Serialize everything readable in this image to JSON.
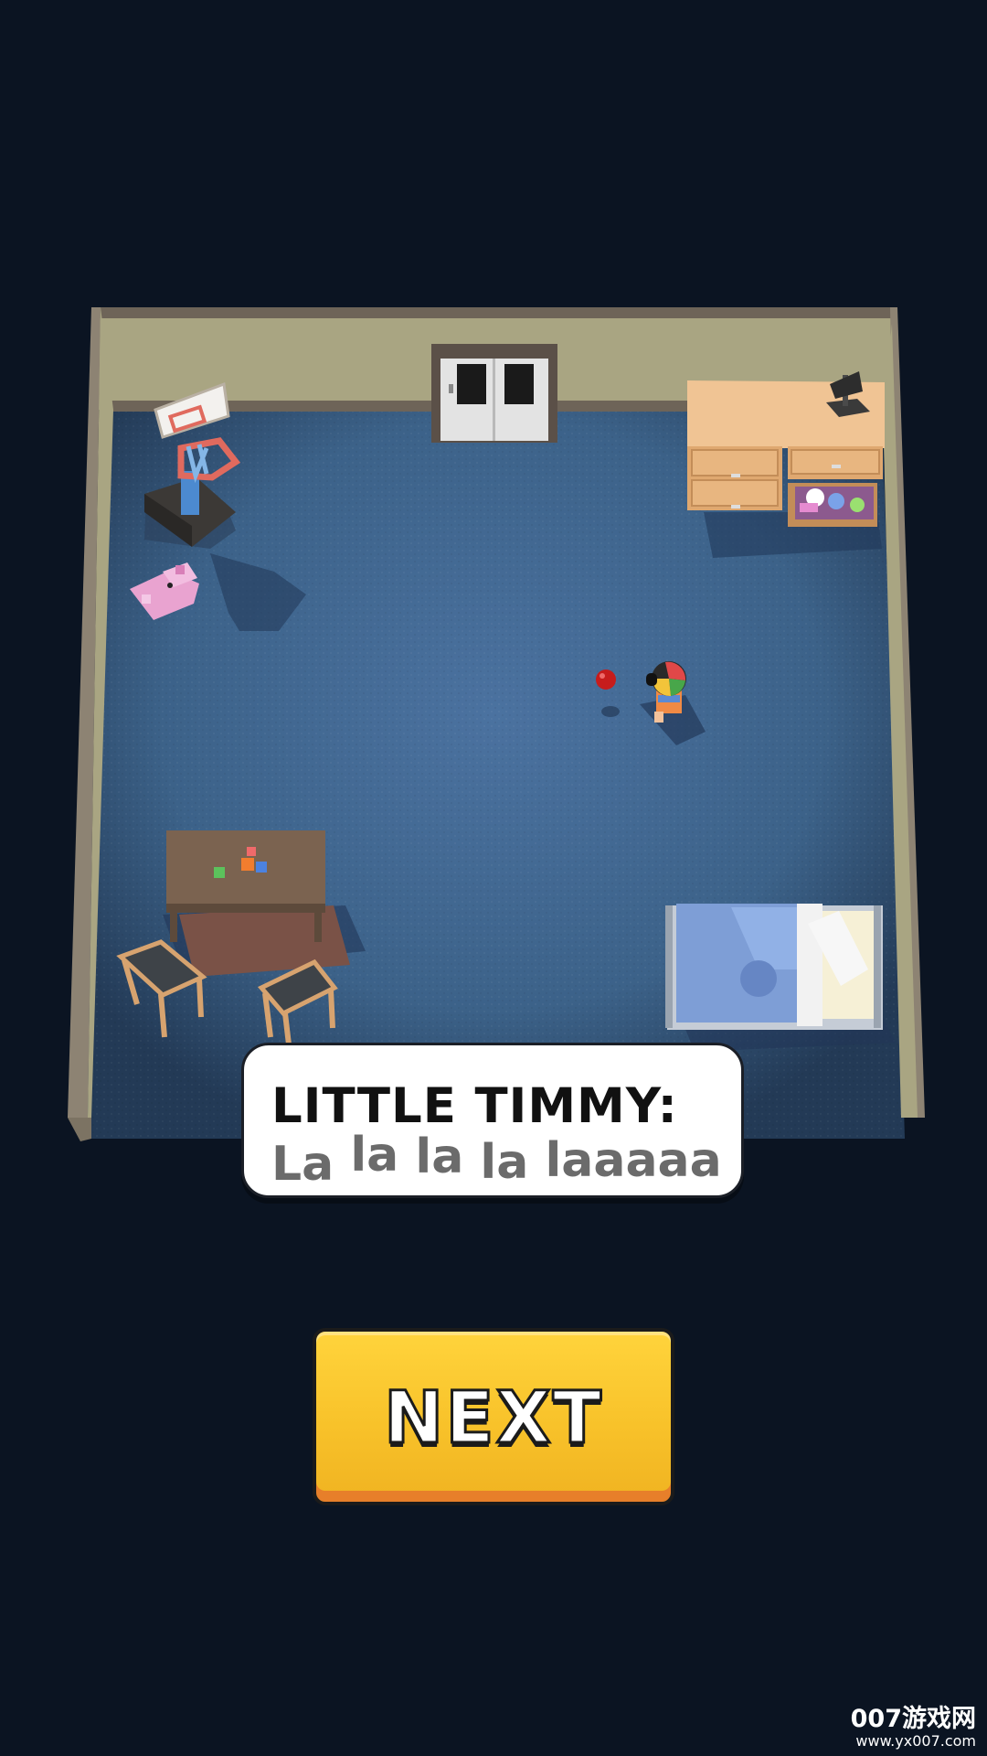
{
  "dialog": {
    "speaker": "LITTLE TIMMY:",
    "line_words": [
      "La",
      "la",
      "la",
      "la",
      "laaaaa"
    ]
  },
  "buttons": {
    "next_label": "NEXT"
  },
  "watermark": {
    "brand": "007游戏网",
    "url": "www.yx007.com"
  },
  "colors": {
    "background": "#0b1422",
    "floor": "#3c6289",
    "wall": "#a9a582",
    "button": "#f8c22a",
    "button_bottom": "#e77f2a"
  },
  "scene_objects": [
    "basketball-hoop",
    "plush-toy",
    "ball",
    "timmy-character",
    "dresser",
    "lamp",
    "toy-table",
    "rug",
    "chair",
    "chair",
    "bed",
    "door"
  ]
}
